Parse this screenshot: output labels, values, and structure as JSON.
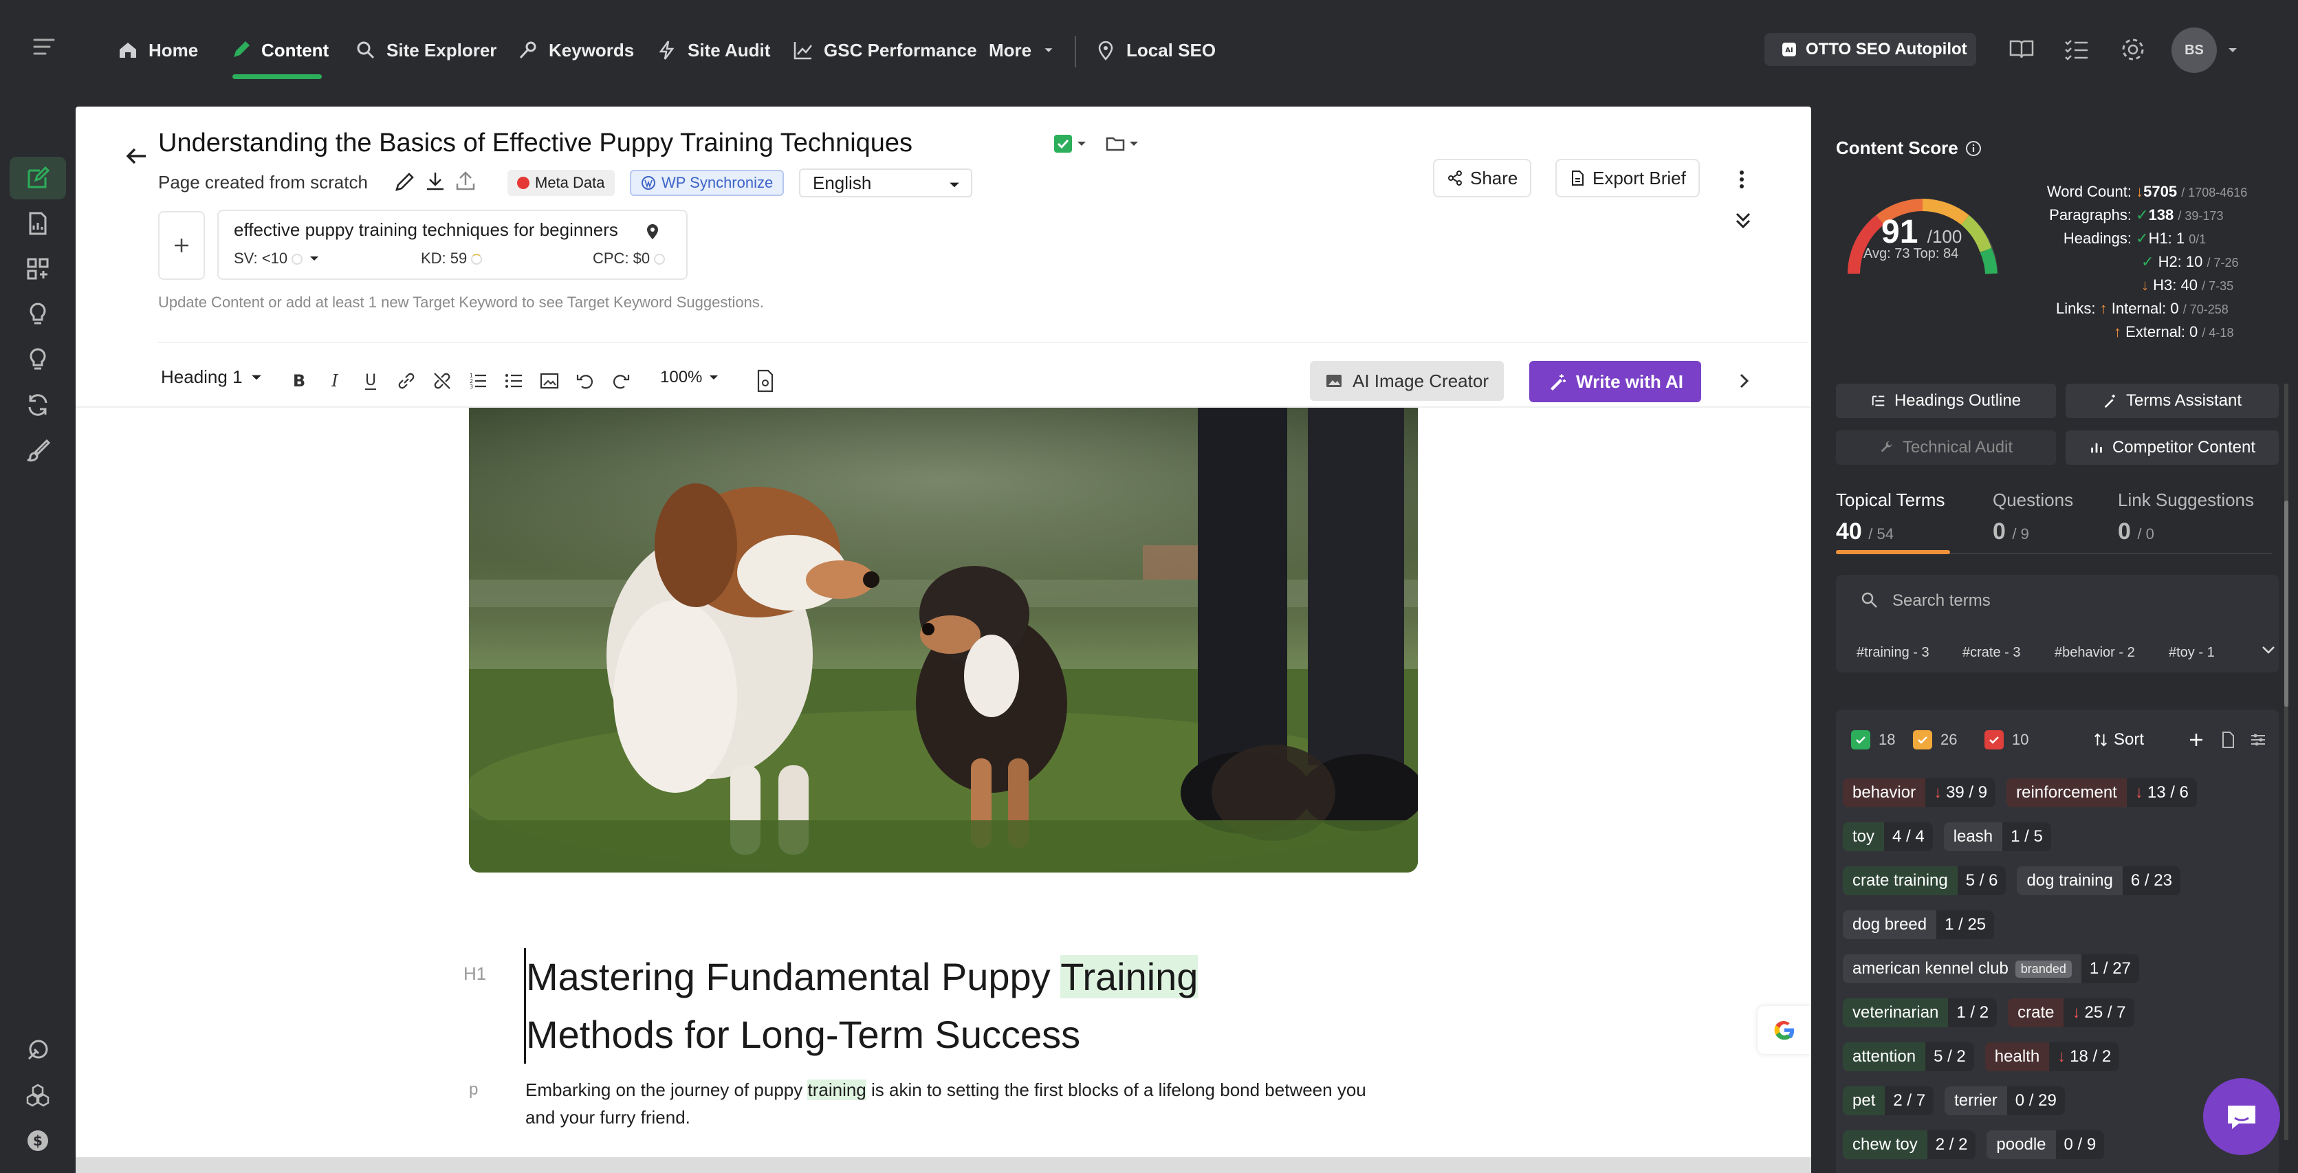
{
  "nav": {
    "items": [
      {
        "label": "Home",
        "icon": "home-icon"
      },
      {
        "label": "Content",
        "icon": "pen-icon"
      },
      {
        "label": "Site Explorer",
        "icon": "magnifier-icon"
      },
      {
        "label": "Keywords",
        "icon": "key-icon"
      },
      {
        "label": "Site Audit",
        "icon": "bolt-icon"
      },
      {
        "label": "GSC Performance",
        "icon": "chart-icon"
      },
      {
        "label": "More",
        "icon": "chevron-down-icon"
      },
      {
        "label": "Local SEO",
        "icon": "pin-icon"
      }
    ],
    "otto_label": "OTTO SEO Autopilot",
    "avatar_initials": "BS",
    "accent": "#2cae5b"
  },
  "editor": {
    "title": "Understanding the Basics of Effective Puppy Training Techniques",
    "subtitle": "Page created from scratch",
    "meta_data_label": "Meta Data",
    "wp_sync_label": "WP Synchronize",
    "language": "English",
    "share_label": "Share",
    "export_label": "Export Brief",
    "keyword": {
      "name": "effective puppy training techniques for beginners",
      "sv": "SV: <10",
      "kd": "KD: 59",
      "cpc": "CPC: $0"
    },
    "keyword_hint": "Update Content or add at least 1 new Target Keyword to see Target Keyword Suggestions.",
    "toolbar": {
      "heading": "Heading 1",
      "zoom": "100%",
      "ai_image_label": "AI Image Creator",
      "write_ai_label": "Write with AI"
    },
    "h1_tag": "H1",
    "h1_before": "Mastering Fundamental Puppy ",
    "h1_highlight": "Training",
    "h1_after": " Methods for Long-Term Success",
    "p_tag": "p",
    "p_before": "Embarking on the journey of puppy ",
    "p_highlight": "training",
    "p_after": " is akin to setting the first blocks of a lifelong bond between you and your furry friend."
  },
  "score": {
    "title": "Content Score",
    "value": "91",
    "max": "/100",
    "avg_top": "Avg: 73 Top: 84",
    "gauge_fraction": 0.91,
    "stats": {
      "word_count_label": "Word Count:",
      "word_count": "5705",
      "word_count_range": "/ 1708-4616",
      "paragraphs_label": "Paragraphs:",
      "paragraphs": "138",
      "paragraphs_range": "/ 39-173",
      "headings_label": "Headings:",
      "h1": "H1: 1",
      "h1_range": "0/1",
      "h2": "H2: 10",
      "h2_range": "/ 7-26",
      "h3": "H3: 40",
      "h3_range": "/ 7-35",
      "links_label": "Links:",
      "internal": "Internal: 0",
      "internal_range": "/ 70-258",
      "external": "External: 0",
      "external_range": "/ 4-18"
    }
  },
  "right_tabs": {
    "headings_outline": "Headings Outline",
    "terms_assistant": "Terms Assistant",
    "technical_audit": "Technical Audit",
    "competitor_content": "Competitor Content"
  },
  "term_tabs": [
    {
      "label": "Topical Terms",
      "num": "40",
      "den": "/ 54"
    },
    {
      "label": "Questions",
      "num": "0",
      "den": "/ 9"
    },
    {
      "label": "Link Suggestions",
      "num": "0",
      "den": "/ 0"
    }
  ],
  "search": {
    "placeholder": "Search terms",
    "hashtags": [
      "#training - 3",
      "#crate - 3",
      "#behavior - 2",
      "#toy - 1"
    ]
  },
  "counts": {
    "green": "18",
    "orange": "26",
    "red": "10",
    "sort": "Sort"
  },
  "terms": [
    {
      "name": "behavior",
      "val": "39 / 9",
      "state": "red",
      "arrow": true
    },
    {
      "name": "reinforcement",
      "val": "13 / 6",
      "state": "red",
      "arrow": true
    },
    {
      "name": "toy",
      "val": "4 / 4",
      "state": "green",
      "arrow": false
    },
    {
      "name": "leash",
      "val": "1 / 5",
      "state": "none",
      "arrow": false
    },
    {
      "name": "crate training",
      "val": "5 / 6",
      "state": "green",
      "arrow": false
    },
    {
      "name": "dog training",
      "val": "6 / 23",
      "state": "none",
      "arrow": false
    },
    {
      "name": "dog breed",
      "val": "1 / 25",
      "state": "none",
      "arrow": false
    },
    {
      "name": "american kennel club",
      "badge": "branded",
      "val": "1 / 27",
      "state": "none",
      "arrow": false
    },
    {
      "name": "veterinarian",
      "val": "1 / 2",
      "state": "green",
      "arrow": false
    },
    {
      "name": "crate",
      "val": "25 / 7",
      "state": "red",
      "arrow": true
    },
    {
      "name": "attention",
      "val": "5 / 2",
      "state": "green",
      "arrow": false
    },
    {
      "name": "health",
      "val": "18 / 2",
      "state": "red",
      "arrow": true
    },
    {
      "name": "pet",
      "val": "2 / 7",
      "state": "green",
      "arrow": false
    },
    {
      "name": "terrier",
      "val": "0 / 29",
      "state": "none",
      "arrow": false
    },
    {
      "name": "chew toy",
      "val": "2 / 2",
      "state": "green",
      "arrow": false
    },
    {
      "name": "poodle",
      "val": "0 / 9",
      "state": "none",
      "arrow": false
    }
  ]
}
